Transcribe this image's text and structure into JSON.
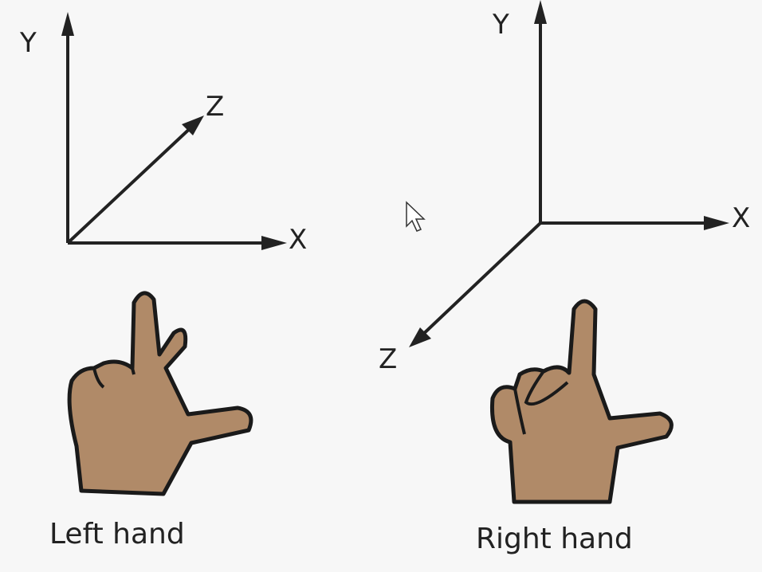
{
  "left": {
    "axes": {
      "y": "Y",
      "z": "Z",
      "x": "X"
    },
    "caption": "Left hand"
  },
  "right": {
    "axes": {
      "y": "Y",
      "z": "Z",
      "x": "X"
    },
    "caption": "Right hand"
  },
  "colors": {
    "skin": "#b08a68",
    "ink": "#222222",
    "background": "#f7f7f7"
  },
  "icons": {
    "cursor": "mouse-pointer-arrow"
  }
}
